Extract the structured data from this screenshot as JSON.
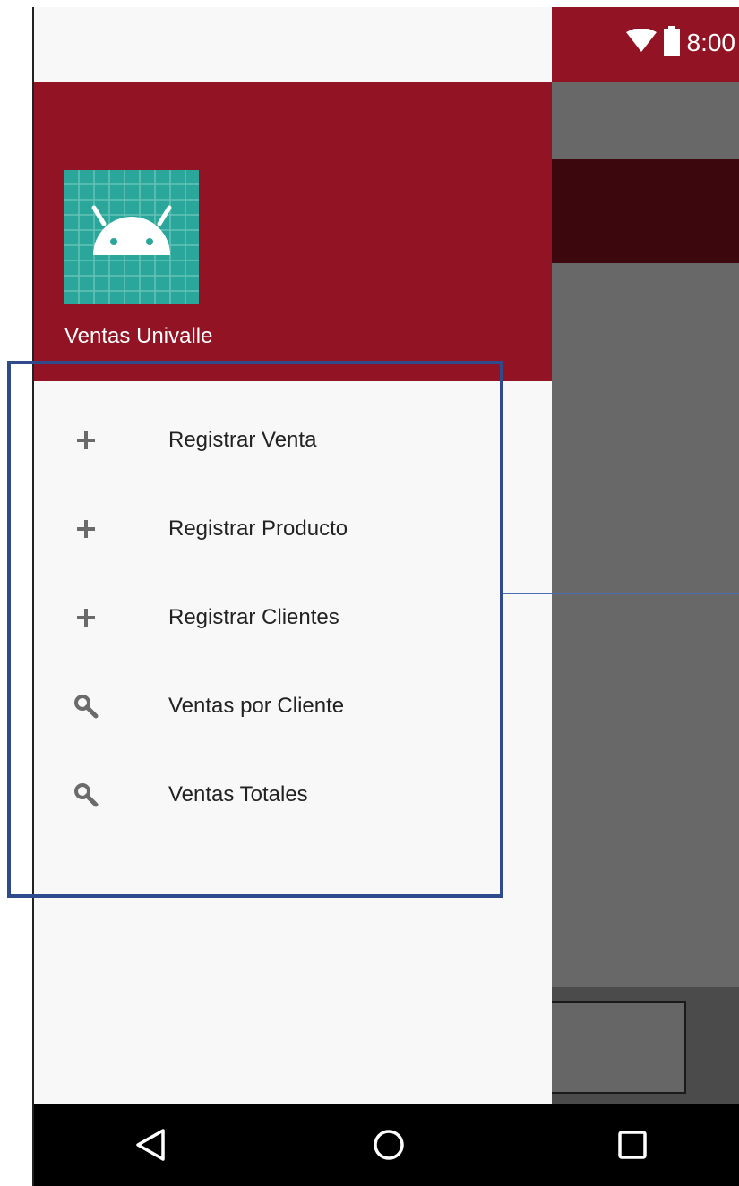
{
  "status_bar": {
    "time": "8:00",
    "icons": [
      "wifi-icon",
      "battery-icon"
    ]
  },
  "drawer": {
    "header": {
      "app_icon": "android-icon",
      "app_name": "Ventas Univalle"
    },
    "menu": [
      {
        "icon": "plus-icon",
        "label": "Registrar Venta"
      },
      {
        "icon": "plus-icon",
        "label": "Registrar Producto"
      },
      {
        "icon": "plus-icon",
        "label": "Registrar Clientes"
      },
      {
        "icon": "search-icon",
        "label": "Ventas por Cliente"
      },
      {
        "icon": "search-icon",
        "label": "Ventas Totales"
      }
    ]
  },
  "nav_bar": {
    "buttons": [
      "back-icon",
      "home-icon",
      "recents-icon"
    ]
  },
  "colors": {
    "primary": "#921323",
    "primary_dark": "#3d070e",
    "scrim": "#686868",
    "drawer_bg": "#f8f8f8",
    "highlight": "#2f4b8c"
  }
}
